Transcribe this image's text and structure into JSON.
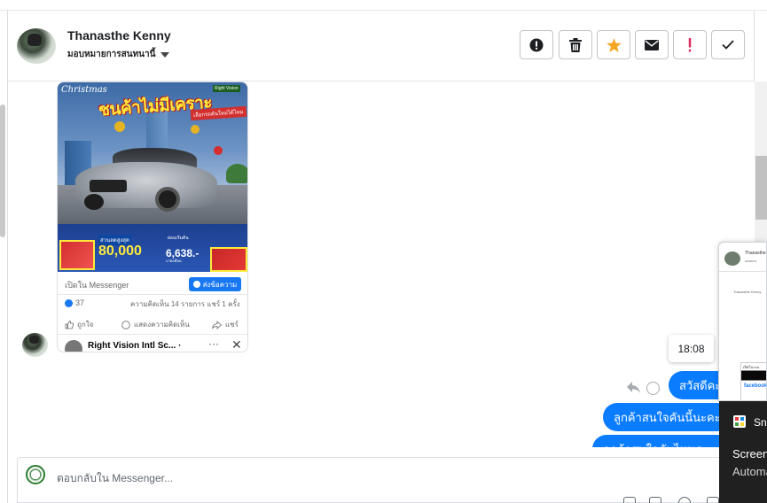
{
  "header": {
    "contact_name": "Thanasthe Kenny",
    "assign_label": "มอบหมายการสนทนานี้",
    "buttons": [
      {
        "name": "spam",
        "icon": "alert-circle-icon"
      },
      {
        "name": "delete",
        "icon": "trash-icon"
      },
      {
        "name": "star",
        "icon": "star-icon",
        "color": "#f5a623"
      },
      {
        "name": "mark-unread",
        "icon": "envelope-icon"
      },
      {
        "name": "follow-up",
        "icon": "exclamation-icon",
        "color": "#e0245e"
      },
      {
        "name": "done",
        "icon": "check-icon"
      }
    ]
  },
  "shared_post": {
    "ad": {
      "script_text": "Christmas",
      "headline": "ชนค้าไม่มีเคราะ",
      "tag": "เลือกรถคันใหม่ได้ไหม",
      "brand": "Right Vision",
      "price_label": "ส่วนลดสูงสุด",
      "price_main": "80,000",
      "installment_label": "ผ่อนเริ่มต้น",
      "installment": "6,638.-",
      "installment_unit": "บาท/เดือน"
    },
    "open_in": "เปิดใน Messenger",
    "send_button": "ส่งข้อความ",
    "likes": "37",
    "comments": "ความคิดเห็น 14 รายการ  แชร์ 1 ครั้ง",
    "actions": {
      "like": "ถูกใจ",
      "comment": "แสดงความคิดเห็น",
      "share": "แชร์"
    },
    "sender_name": "Right Vision Intl Sc...",
    "sender_dot": "·",
    "more": "···",
    "close": "✕"
  },
  "conversation": {
    "time_chip": "18:08",
    "outgoing": [
      "สวัสดีคะ",
      "ลูกค้าสนใจคันนี้นะคะ",
      "ลูกค้าสนใจคันไหนคะ"
    ]
  },
  "composer": {
    "placeholder": "ตอบกลับใน Messenger..."
  },
  "snip_overlay": {
    "preview_name": "Thanasthe",
    "preview_sub": "มอบหมาย",
    "preview_text": "Thanasthe Kenny",
    "preview_card_text": "เปิดใน ma",
    "preview_brand": "facebook",
    "app_name": "Snipping Tool",
    "title": "Screenshot copied",
    "body": "Automatically saved"
  },
  "colors": {
    "accent": "#0a7cff",
    "messenger_blue": "#1877f2",
    "star": "#f5a623",
    "follow_up": "#e0245e"
  }
}
